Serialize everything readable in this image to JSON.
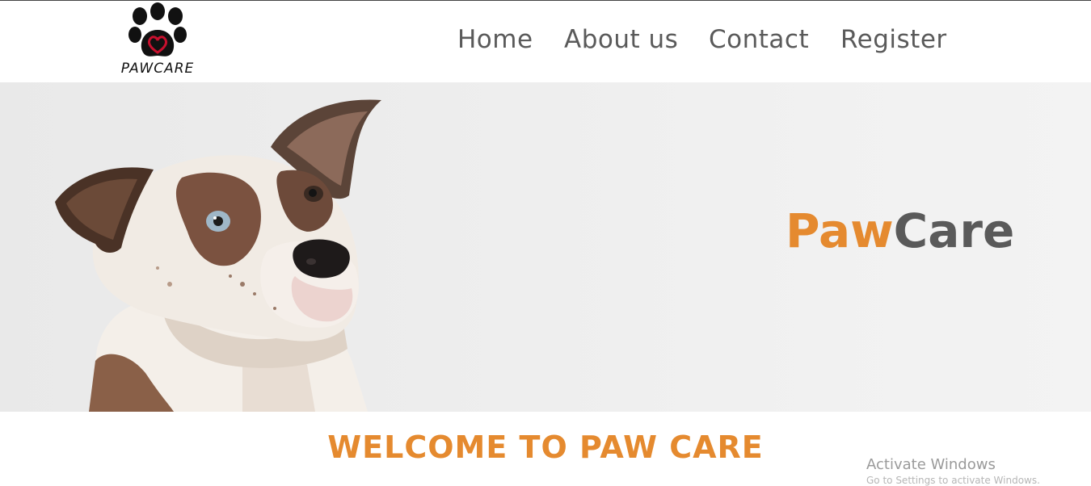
{
  "header": {
    "logo_text": "PAWCARE",
    "nav": [
      {
        "label": "Home"
      },
      {
        "label": "About us"
      },
      {
        "label": "Contact"
      },
      {
        "label": "Register"
      }
    ]
  },
  "hero": {
    "brand_part1": "Paw",
    "brand_part2": "Care"
  },
  "main": {
    "welcome": "WELCOME TO PAW CARE"
  },
  "watermark": {
    "line1": "Activate Windows",
    "line2": "Go to Settings to activate Windows."
  },
  "colors": {
    "accent": "#e58a2f",
    "text_gray": "#5a5a5a"
  }
}
